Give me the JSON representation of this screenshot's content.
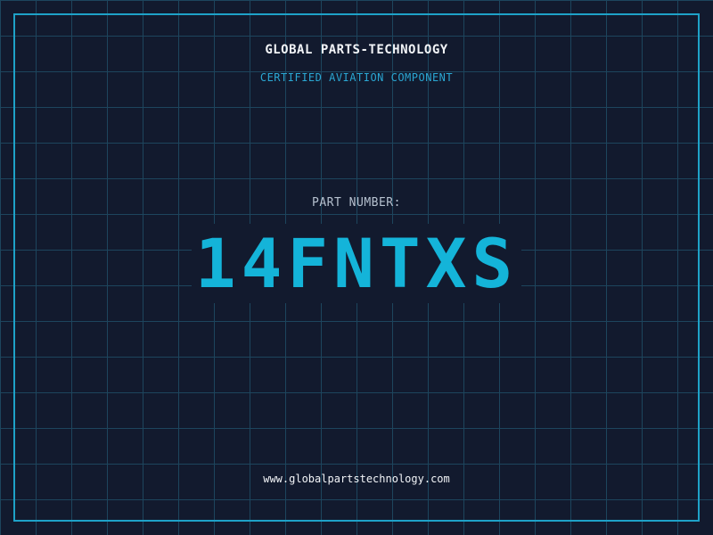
{
  "header": {
    "company": "GLOBAL PARTS-TECHNOLOGY",
    "tagline": "CERTIFIED AVIATION COMPONENT"
  },
  "part": {
    "label": "PART NUMBER:",
    "number": "14FNTXS"
  },
  "footer": {
    "website": "www.globalpartstechnology.com"
  },
  "colors": {
    "background": "#121a2e",
    "grid": "#1f4a63",
    "frame": "#1ea2c8",
    "accent": "#14b4d9",
    "text": "#f2f4f7"
  }
}
